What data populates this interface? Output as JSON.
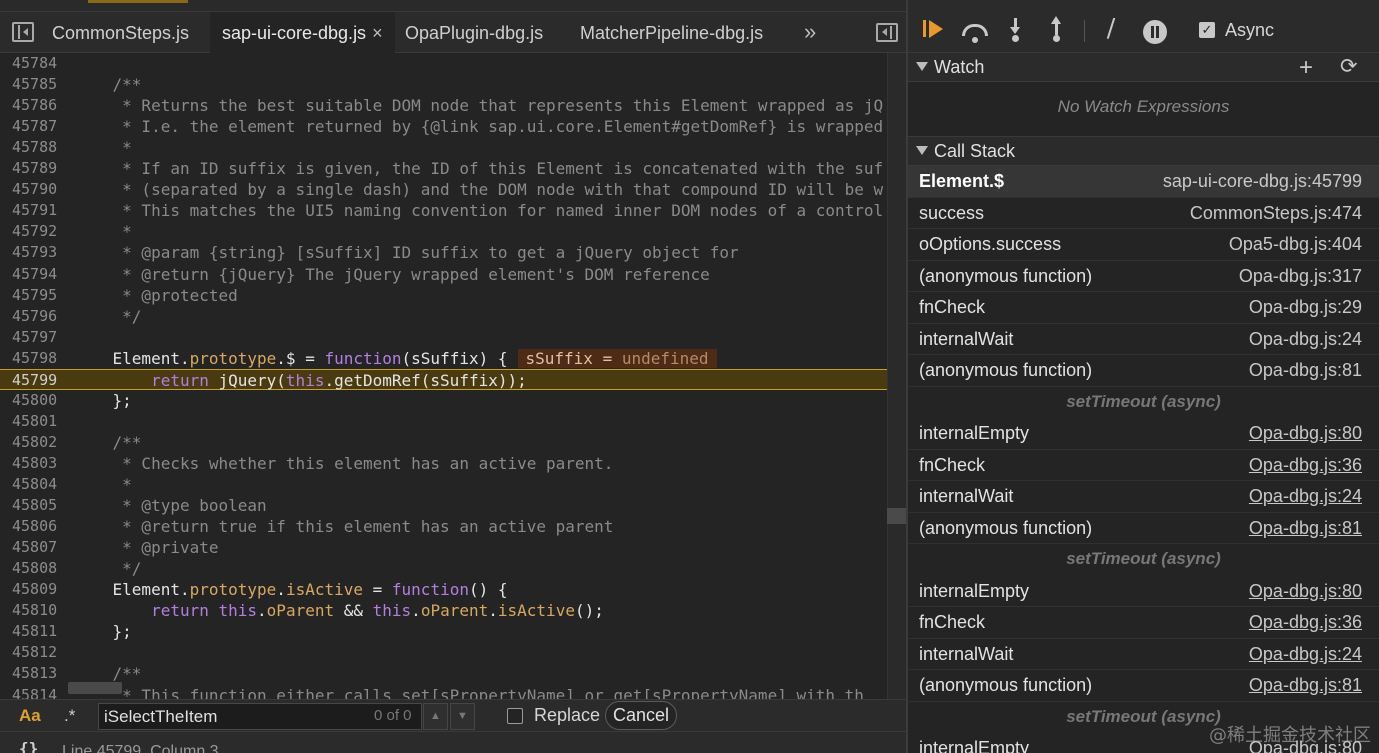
{
  "editor": {
    "tabs": [
      {
        "label": "CommonSteps.js"
      },
      {
        "label": "sap-ui-core-dbg.js",
        "close": "×"
      },
      {
        "label": "OpaPlugin-dbg.js"
      },
      {
        "label": "MatcherPipeline-dbg.js"
      }
    ],
    "more_tabs": "»",
    "inline_value": {
      "name": "sSuffix",
      "eq": " = ",
      "value": "undefined"
    },
    "search": {
      "case_label": "Aa",
      "regex_label": ".*",
      "query": "iSelectTheItem",
      "count": "0 of 0",
      "replace_label": "Replace",
      "cancel_label": "Cancel"
    },
    "status": {
      "braces": "{}",
      "position": "Line 45799, Column 3"
    }
  },
  "code_lines": [
    {
      "n": "45784"
    },
    {
      "n": "45785",
      "c": "    /**"
    },
    {
      "n": "45786",
      "c": "     * Returns the best suitable DOM node that represents this Element wrapped as jQ"
    },
    {
      "n": "45787",
      "c": "     * I.e. the element returned by {@link sap.ui.core.Element#getDomRef} is wrapped"
    },
    {
      "n": "45788",
      "c": "     *"
    },
    {
      "n": "45789",
      "c": "     * If an ID suffix is given, the ID of this Element is concatenated with the suf"
    },
    {
      "n": "45790",
      "c": "     * (separated by a single dash) and the DOM node with that compound ID will be w"
    },
    {
      "n": "45791",
      "c": "     * This matches the UI5 naming convention for named inner DOM nodes of a control"
    },
    {
      "n": "45792",
      "c": "     *"
    },
    {
      "n": "45793",
      "c": "     * @param {string} [sSuffix] ID suffix to get a jQuery object for"
    },
    {
      "n": "45794",
      "c": "     * @return {jQuery} The jQuery wrapped element's DOM reference"
    },
    {
      "n": "45795",
      "c": "     * @protected"
    },
    {
      "n": "45796",
      "c": "     */"
    },
    {
      "n": "45797"
    },
    {
      "n": "45798",
      "t": [
        [
          "    Element.",
          "txt"
        ],
        [
          "prototype",
          "prop"
        ],
        [
          ".$ = ",
          "txt"
        ],
        [
          "function",
          "kw"
        ],
        [
          "(sSuffix) {",
          "txt"
        ]
      ],
      "inline": true
    },
    {
      "n": "45799",
      "t": [
        [
          "        ",
          "txt"
        ],
        [
          "return",
          "kw"
        ],
        [
          " jQuery(",
          "txt"
        ],
        [
          "this",
          "kw"
        ],
        [
          ".getDomRef(sSuffix));",
          "txt"
        ]
      ],
      "current": true
    },
    {
      "n": "45800",
      "t": [
        [
          "    };",
          "txt"
        ]
      ]
    },
    {
      "n": "45801"
    },
    {
      "n": "45802",
      "c": "    /**"
    },
    {
      "n": "45803",
      "c": "     * Checks whether this element has an active parent."
    },
    {
      "n": "45804",
      "c": "     *"
    },
    {
      "n": "45805",
      "c": "     * @type boolean"
    },
    {
      "n": "45806",
      "c": "     * @return true if this element has an active parent"
    },
    {
      "n": "45807",
      "c": "     * @private"
    },
    {
      "n": "45808",
      "c": "     */"
    },
    {
      "n": "45809",
      "t": [
        [
          "    Element.",
          "txt"
        ],
        [
          "prototype",
          "prop"
        ],
        [
          ".",
          "txt"
        ],
        [
          "isActive",
          "prop"
        ],
        [
          " = ",
          "txt"
        ],
        [
          "function",
          "kw"
        ],
        [
          "() {",
          "txt"
        ]
      ]
    },
    {
      "n": "45810",
      "t": [
        [
          "        ",
          "txt"
        ],
        [
          "return",
          "kw"
        ],
        [
          " ",
          "txt"
        ],
        [
          "this",
          "kw"
        ],
        [
          ".",
          "txt"
        ],
        [
          "oParent",
          "prop"
        ],
        [
          " && ",
          "txt"
        ],
        [
          "this",
          "kw"
        ],
        [
          ".",
          "txt"
        ],
        [
          "oParent",
          "prop"
        ],
        [
          ".",
          "txt"
        ],
        [
          "isActive",
          "prop"
        ],
        [
          "();",
          "txt"
        ]
      ]
    },
    {
      "n": "45811",
      "t": [
        [
          "    };",
          "txt"
        ]
      ]
    },
    {
      "n": "45812"
    },
    {
      "n": "45813",
      "c": "    /**"
    },
    {
      "n": "45814",
      "c": "     * This function either calls set[sPropertyName] or get[sPropertyName] with th"
    }
  ],
  "debugger": {
    "async_label": "Async",
    "watch": {
      "title": "Watch",
      "empty": "No Watch Expressions"
    },
    "call_stack": {
      "title": "Call Stack",
      "frames": [
        {
          "fn": "Element.$",
          "loc": "sap-ui-core-dbg.js:45799",
          "selected": true
        },
        {
          "fn": "success",
          "loc": "CommonSteps.js:474"
        },
        {
          "fn": "oOptions.success",
          "loc": "Opa5-dbg.js:404"
        },
        {
          "fn": "(anonymous function)",
          "loc": "Opa-dbg.js:317"
        },
        {
          "fn": "fnCheck",
          "loc": "Opa-dbg.js:29"
        },
        {
          "fn": "internalWait",
          "loc": "Opa-dbg.js:24"
        },
        {
          "fn": "(anonymous function)",
          "loc": "Opa-dbg.js:81"
        },
        {
          "sep": "setTimeout (async)"
        },
        {
          "fn": "internalEmpty",
          "loc": "Opa-dbg.js:80",
          "link": true
        },
        {
          "fn": "fnCheck",
          "loc": "Opa-dbg.js:36",
          "link": true
        },
        {
          "fn": "internalWait",
          "loc": "Opa-dbg.js:24",
          "link": true
        },
        {
          "fn": "(anonymous function)",
          "loc": "Opa-dbg.js:81",
          "link": true
        },
        {
          "sep": "setTimeout (async)"
        },
        {
          "fn": "internalEmpty",
          "loc": "Opa-dbg.js:80",
          "link": true
        },
        {
          "fn": "fnCheck",
          "loc": "Opa-dbg.js:36",
          "link": true
        },
        {
          "fn": "internalWait",
          "loc": "Opa-dbg.js:24",
          "link": true
        },
        {
          "fn": "(anonymous function)",
          "loc": "Opa-dbg.js:81",
          "link": true
        },
        {
          "sep": "setTimeout (async)"
        },
        {
          "fn": "internalEmpty",
          "loc": "Opa-dbg.js:80",
          "link": true
        }
      ]
    }
  },
  "watermark": "@稀土掘金技术社区"
}
